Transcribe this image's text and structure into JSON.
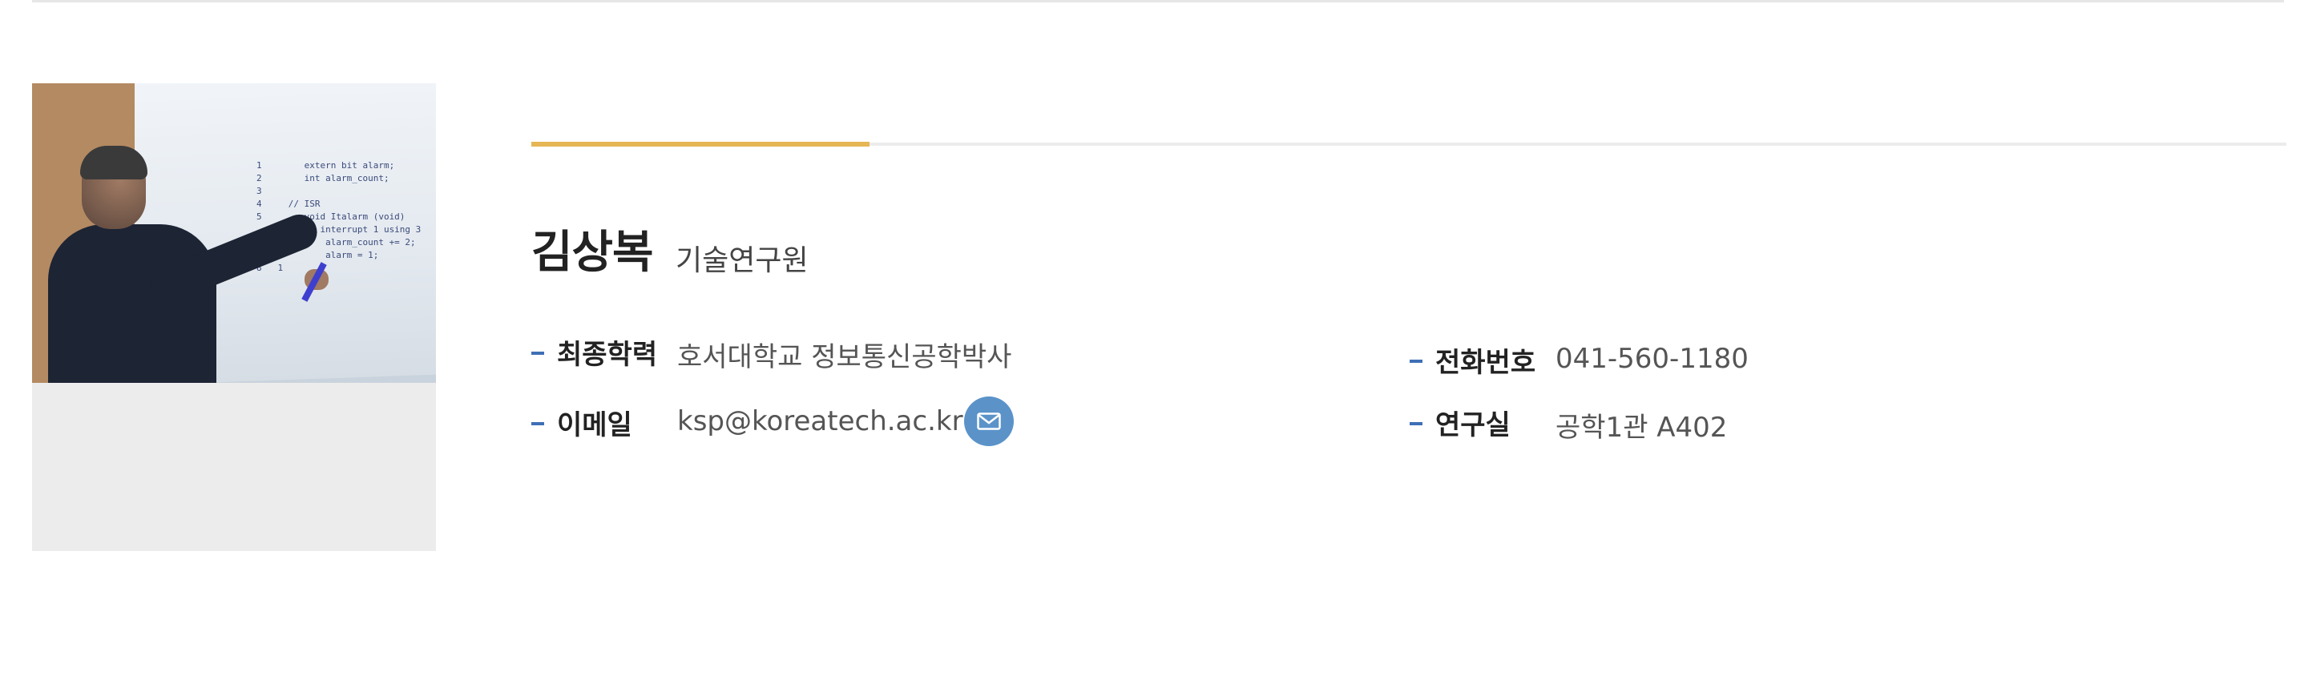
{
  "profile": {
    "name": "김상복",
    "title": "기술연구원",
    "photo_alt": "",
    "photo_code": "1        extern bit alarm;\n2        int alarm_count;\n3\n4     // ISR\n5        void Italarm (void)\n            interrupt 1 using 3\n6   1        alarm_count += 2;\n7   1        alarm = 1;\n8   1"
  },
  "details": {
    "education_label": "최종학력",
    "education_value": "호서대학교 정보통신공학박사",
    "email_label": "이메일",
    "email_value": "ksp@koreatech.ac.kr",
    "phone_label": "전화번호",
    "phone_value": "041-560-1180",
    "office_label": "연구실",
    "office_value": "공학1관 A402"
  },
  "icons": {
    "mail": "envelope-icon"
  },
  "colors": {
    "accent": "#e6b655",
    "dash": "#3e6fb6",
    "mail_button": "#5b93c9",
    "card_bg": "#ececec"
  }
}
